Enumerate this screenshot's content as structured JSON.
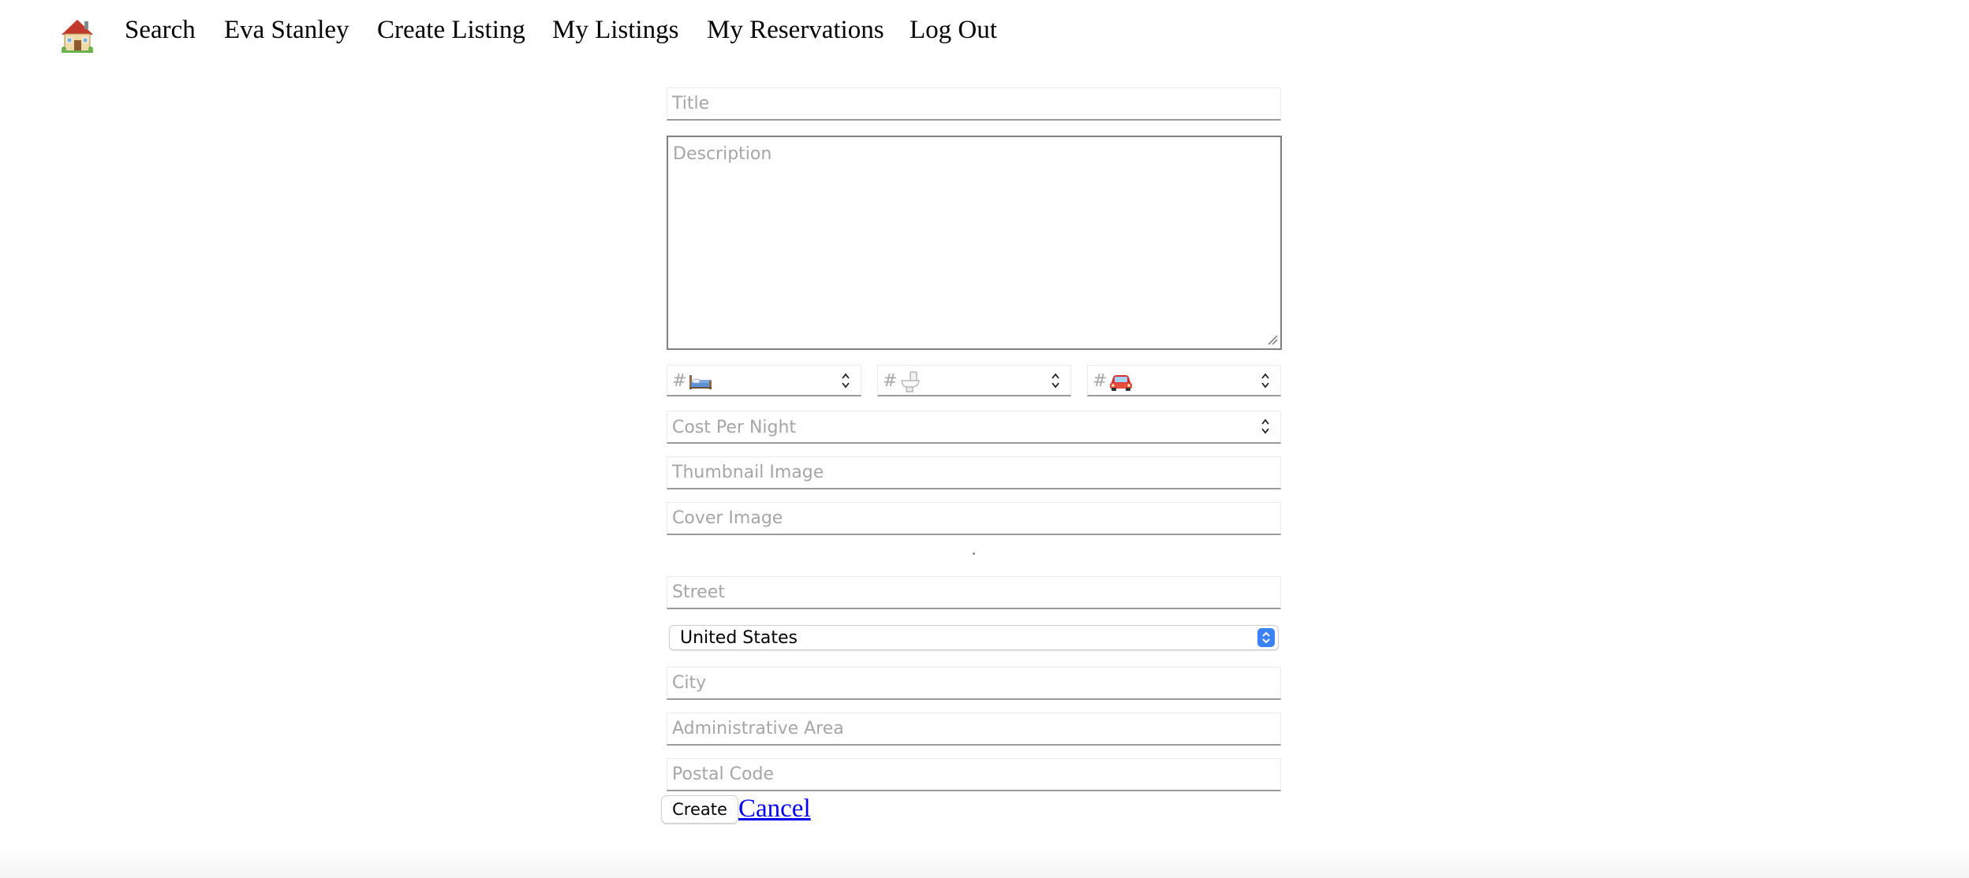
{
  "nav": {
    "home_icon": "house-emoji-icon",
    "links": [
      "Search",
      "Eva Stanley",
      "Create Listing",
      "My Listings",
      "My Reservations",
      "Log Out"
    ]
  },
  "form": {
    "title_placeholder": "Title",
    "description_placeholder": "Description",
    "bedrooms_prefix": "#",
    "bedrooms_icon": "bed-icon",
    "bathrooms_prefix": "#",
    "bathrooms_icon": "toilet-icon",
    "parking_prefix": "#",
    "parking_icon": "car-icon",
    "cost_placeholder": "Cost Per Night",
    "thumbnail_placeholder": "Thumbnail Image",
    "cover_placeholder": "Cover Image",
    "street_placeholder": "Street",
    "country_selected": "United States",
    "city_placeholder": "City",
    "admin_area_placeholder": "Administrative Area",
    "postal_code_placeholder": "Postal Code",
    "create_label": "Create",
    "cancel_label": "Cancel"
  },
  "colors": {
    "link": "#0000ee",
    "select_accent": "#3b82f6"
  }
}
